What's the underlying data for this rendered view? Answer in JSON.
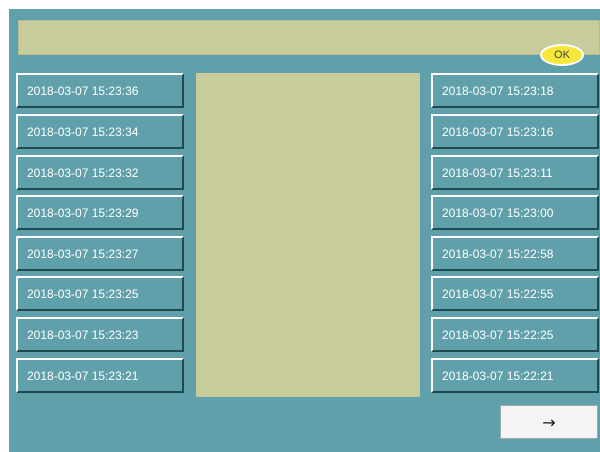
{
  "ok_button": {
    "label": "OK",
    "color": "#f5e83a"
  },
  "left_column": [
    "2018-03-07 15:23:36",
    "2018-03-07 15:23:34",
    "2018-03-07 15:23:32",
    "2018-03-07 15:23:29",
    "2018-03-07 15:23:27",
    "2018-03-07 15:23:25",
    "2018-03-07 15:23:23",
    "2018-03-07 15:23:21"
  ],
  "right_column": [
    "2018-03-07 15:23:18",
    "2018-03-07 15:23:16",
    "2018-03-07 15:23:11",
    "2018-03-07 15:23:00",
    "2018-03-07 15:22:58",
    "2018-03-07 15:22:55",
    "2018-03-07 15:22:25",
    "2018-03-07 15:22:21"
  ],
  "next_button": {
    "label": "→",
    "icon": "arrow-right-icon"
  },
  "colors": {
    "background": "#5fa0aa",
    "panel": "#c8cc9c"
  }
}
